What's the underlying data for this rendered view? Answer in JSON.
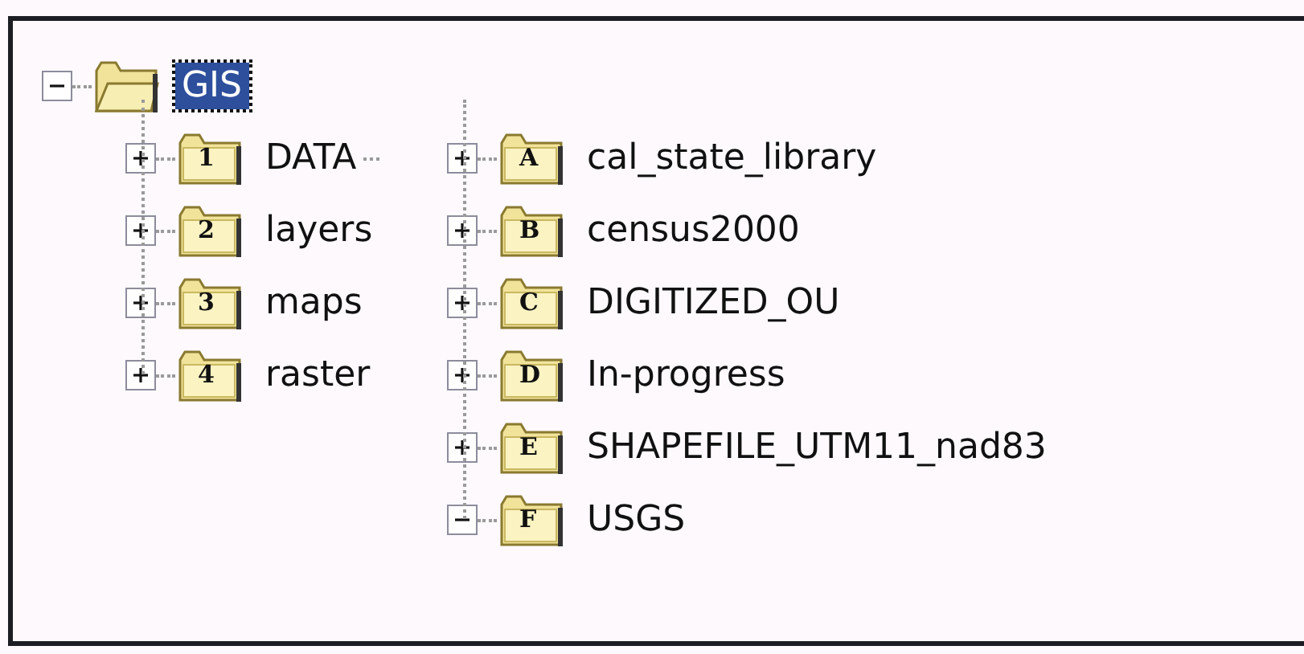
{
  "root": {
    "label": "GIS",
    "expanded": true,
    "selected": true
  },
  "left_items": [
    {
      "label": "DATA",
      "badge": "1",
      "expanded": false
    },
    {
      "label": "layers",
      "badge": "2",
      "expanded": false
    },
    {
      "label": "maps",
      "badge": "3",
      "expanded": false
    },
    {
      "label": "raster",
      "badge": "4",
      "expanded": false
    }
  ],
  "right_items": [
    {
      "label": "cal_state_library",
      "badge": "A",
      "expanded": false
    },
    {
      "label": "census2000",
      "badge": "B",
      "expanded": false
    },
    {
      "label": "DIGITIZED_OU",
      "badge": "C",
      "expanded": false
    },
    {
      "label": "In-progress",
      "badge": "D",
      "expanded": false
    },
    {
      "label": "SHAPEFILE_UTM11_nad83",
      "badge": "E",
      "expanded": false
    },
    {
      "label": "USGS",
      "badge": "F",
      "expanded": true
    }
  ]
}
